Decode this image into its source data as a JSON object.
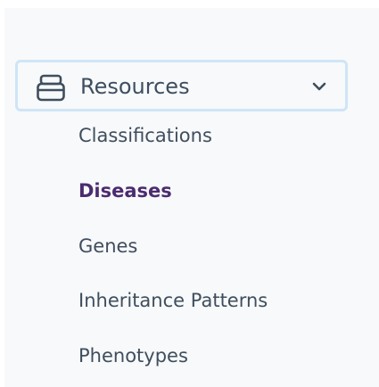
{
  "resources_menu": {
    "icon": "jar-icon",
    "label": "Resources",
    "chevron": "chevron-down-icon",
    "active_color": "#4b2c6f",
    "items": [
      {
        "label": "Classifications",
        "active": false
      },
      {
        "label": "Diseases",
        "active": true
      },
      {
        "label": "Genes",
        "active": false
      },
      {
        "label": "Inheritance Patterns",
        "active": false
      },
      {
        "label": "Phenotypes",
        "active": false
      }
    ]
  }
}
